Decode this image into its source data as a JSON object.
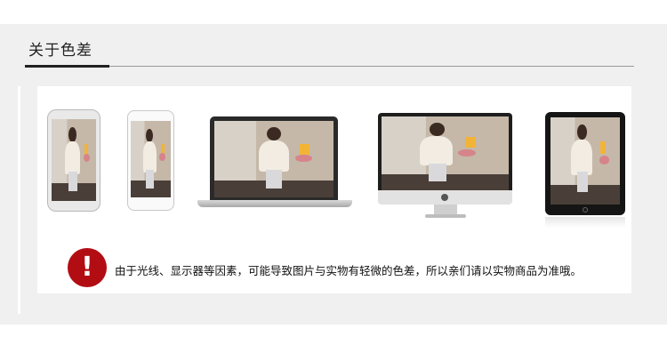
{
  "section": {
    "title": "关于色差"
  },
  "devices": [
    {
      "type": "phone",
      "label": "smartphone-1"
    },
    {
      "type": "phone",
      "label": "smartphone-2"
    },
    {
      "type": "laptop",
      "label": "laptop"
    },
    {
      "type": "desktop",
      "label": "imac"
    },
    {
      "type": "tablet",
      "label": "tablet"
    }
  ],
  "notice": {
    "icon": "exclamation-icon",
    "icon_color": "#b30d14",
    "text": "由于光线、显示器等因素，可能导致图片与实物有轻微的色差，所以亲们请以实物商品为准哦。"
  }
}
